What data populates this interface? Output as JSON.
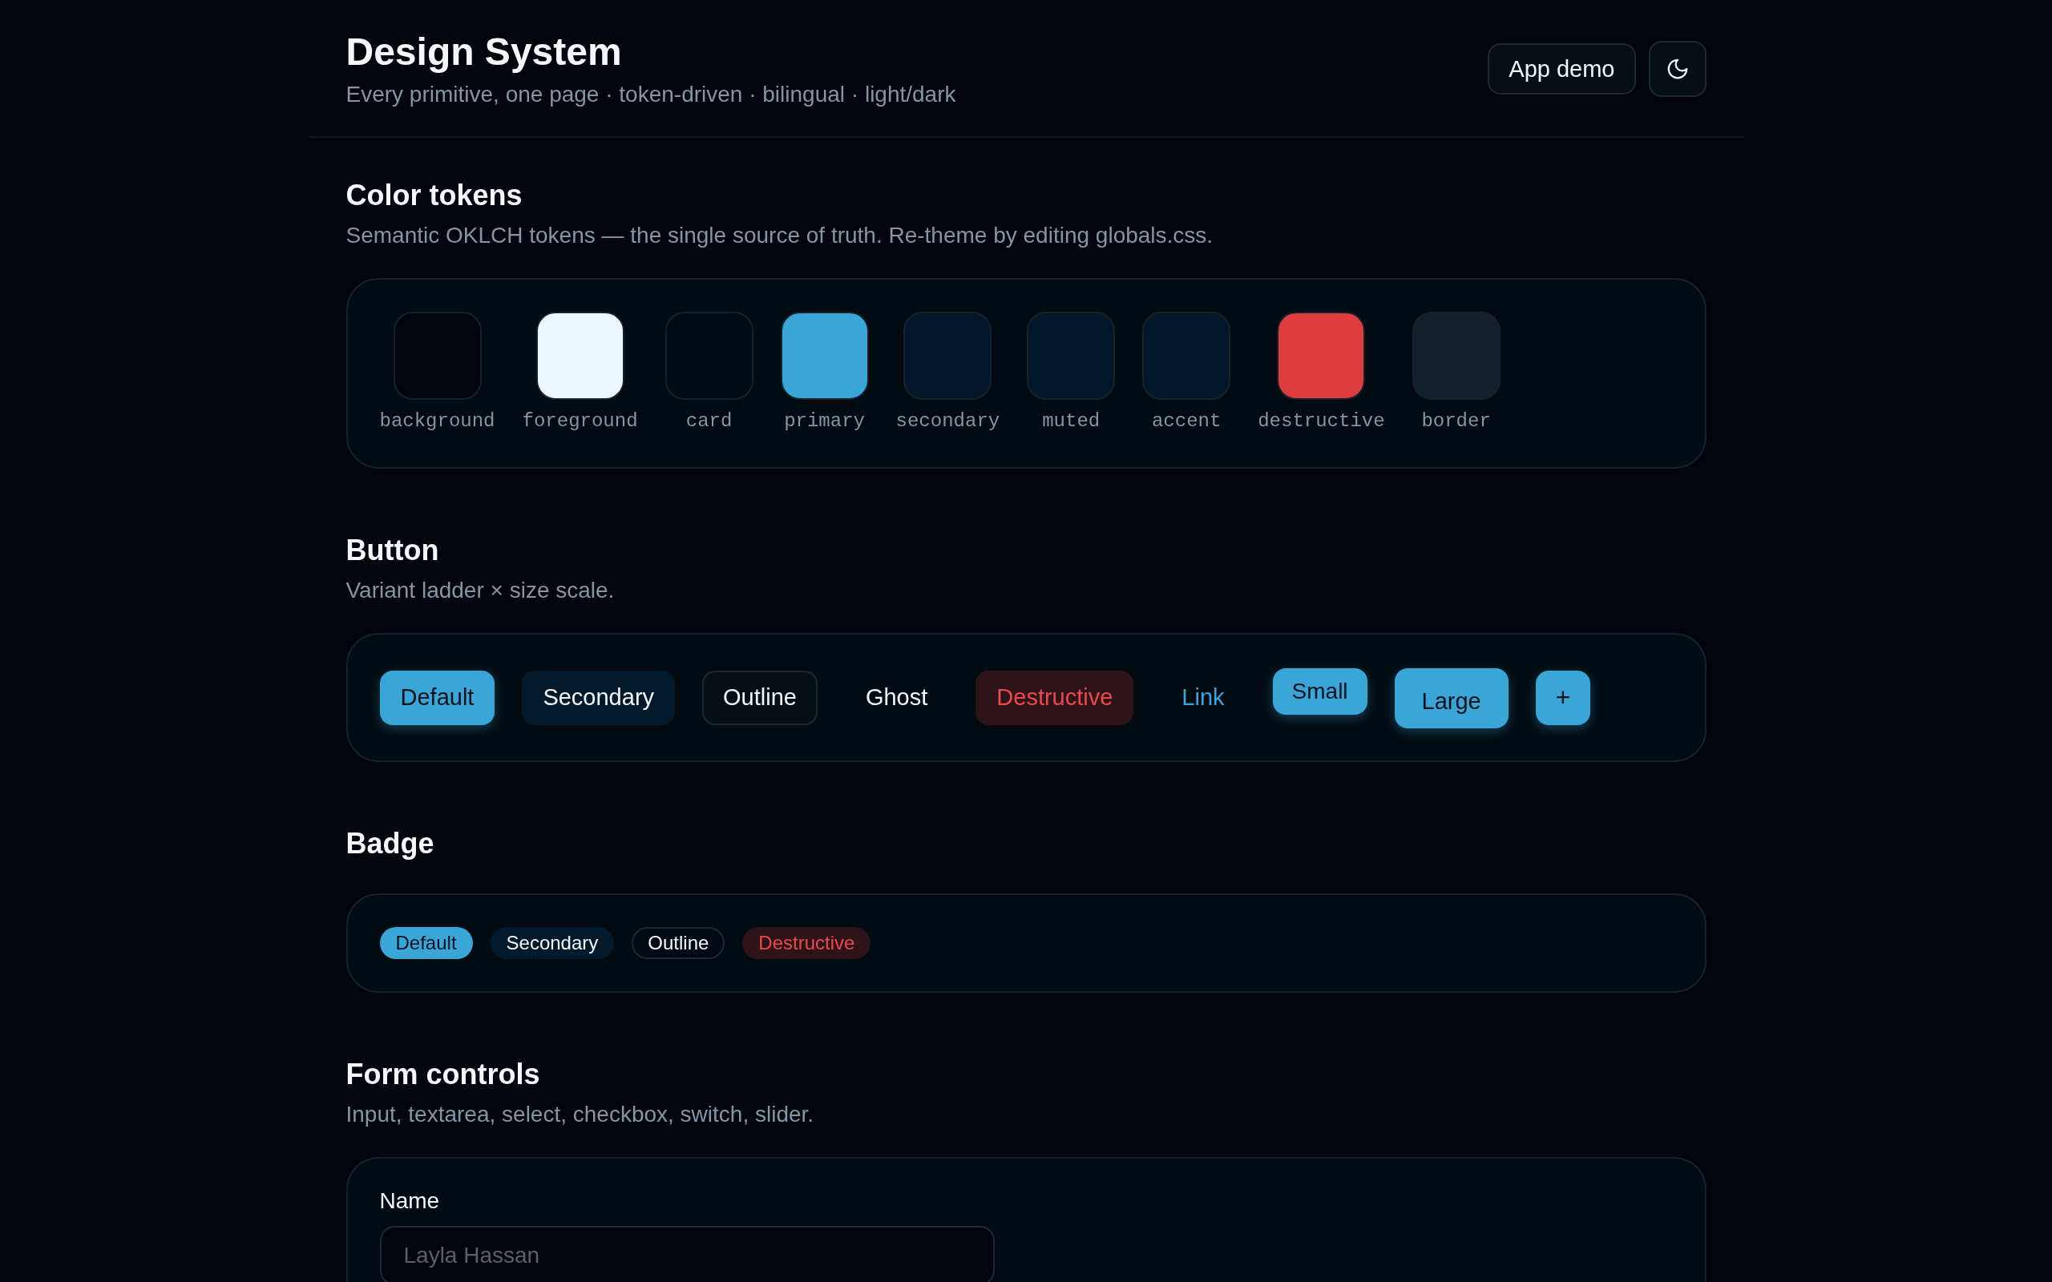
{
  "header": {
    "title": "Design System",
    "subtitle": "Every primitive, one page · token-driven · bilingual · light/dark",
    "demo_button": "App demo"
  },
  "sections": [
    {
      "kind": "colors",
      "title": "Color tokens",
      "description": "Semantic OKLCH tokens — the single source of truth. Re-theme by editing globals.css.",
      "tokens": [
        {
          "name": "background",
          "color": "#02060c"
        },
        {
          "name": "foreground",
          "color": "#eff7fe"
        },
        {
          "name": "card",
          "color": "#020b12"
        },
        {
          "name": "primary",
          "color": "#3aa6d8"
        },
        {
          "name": "secondary",
          "color": "#02182a"
        },
        {
          "name": "muted",
          "color": "#02182a"
        },
        {
          "name": "accent",
          "color": "#02182a"
        },
        {
          "name": "destructive",
          "color": "#de3c3e"
        },
        {
          "name": "border",
          "color": "#13212b"
        }
      ]
    },
    {
      "kind": "buttons",
      "title": "Button",
      "description": "Variant ladder × size scale.",
      "buttons": [
        {
          "label": "Default",
          "kind": "default"
        },
        {
          "label": "Secondary",
          "kind": "secondary"
        },
        {
          "label": "Outline",
          "kind": "outline"
        },
        {
          "label": "Ghost",
          "kind": "ghost"
        },
        {
          "label": "Destructive",
          "kind": "destructive"
        },
        {
          "label": "Link",
          "kind": "link"
        },
        {
          "label": "Small",
          "kind": "small"
        },
        {
          "label": "Large",
          "kind": "large"
        },
        {
          "label": "+",
          "kind": "icon"
        }
      ]
    },
    {
      "kind": "badges",
      "title": "Badge",
      "badges": [
        {
          "label": "Default",
          "kind": "default"
        },
        {
          "label": "Secondary",
          "kind": "secondary"
        },
        {
          "label": "Outline",
          "kind": "outline"
        },
        {
          "label": "Destructive",
          "kind": "destructive"
        }
      ]
    },
    {
      "kind": "form",
      "title": "Form controls",
      "description": "Input, textarea, select, checkbox, switch, slider.",
      "fields": [
        {
          "label": "Name",
          "placeholder": "Layla Hassan"
        }
      ]
    }
  ]
}
